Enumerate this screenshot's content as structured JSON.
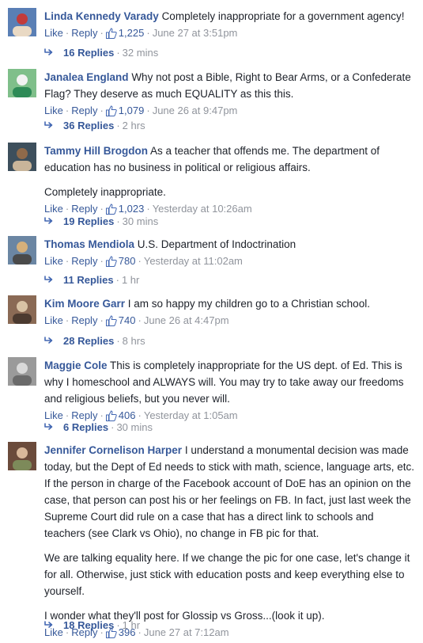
{
  "labels": {
    "like": "Like",
    "reply": "Reply",
    "sep": "·"
  },
  "comments": [
    {
      "author": "Linda Kennedy Varady",
      "paragraphs": [
        "Completely inappropriate for a government agency!"
      ],
      "likes": "1,225",
      "time": "June 27 at 3:51pm",
      "replies": "16 Replies",
      "replies_time": "32 mins"
    },
    {
      "author": "Janalea England",
      "paragraphs": [
        "Why not post a Bible, Right to Bear Arms, or a Confederate Flag? They deserve as much EQUALITY as this this."
      ],
      "likes": "1,079",
      "time": "June 26 at 9:47pm",
      "replies": "36 Replies",
      "replies_time": "2 hrs"
    },
    {
      "author": "Tammy Hill Brogdon",
      "paragraphs": [
        "As a teacher that offends me. The department of education has no business in political or religious affairs.",
        "Completely inappropriate."
      ],
      "likes": "1,023",
      "time": "Yesterday at 10:26am",
      "replies": "19 Replies",
      "replies_time": "30 mins"
    },
    {
      "author": "Thomas Mendiola",
      "paragraphs": [
        "U.S. Department of Indoctrination"
      ],
      "likes": "780",
      "time": "Yesterday at 11:02am",
      "replies": "11 Replies",
      "replies_time": "1 hr"
    },
    {
      "author": "Kim Moore Garr",
      "paragraphs": [
        "I am so happy my children go to a Christian school."
      ],
      "likes": "740",
      "time": "June 26 at 4:47pm",
      "replies": "28 Replies",
      "replies_time": "8 hrs"
    },
    {
      "author": "Maggie Cole",
      "paragraphs": [
        "This is completely inappropriate for the US dept. of Ed. This is why I homeschool and ALWAYS will. You may try to take away our freedoms and religious beliefs, but you never will."
      ],
      "likes": "406",
      "time": "Yesterday at 1:05am",
      "replies": "6 Replies",
      "replies_time": "30 mins"
    },
    {
      "author": "Jennifer Cornelison Harper",
      "paragraphs": [
        "I understand a monumental decision was made today, but the Dept of Ed needs to stick with math, science, language arts, etc. If the person in charge of the Facebook account of DoE has an opinion on the case, that person can post his or her feelings on FB. In fact, just last week the Supreme Court did rule on a case that has a direct link to schools and teachers (see Clark vs Ohio), no change in FB pic for that.",
        "We are talking equality here. If we change the pic for one case, let's change it for all. Otherwise, just stick with education posts and keep everything else to yourself.",
        "I wonder what they'll post for Glossip vs Gross...(look it up)."
      ],
      "likes": "396",
      "time": "June 27 at 7:12am",
      "replies": "18 Replies",
      "replies_time": "1 hr"
    }
  ]
}
